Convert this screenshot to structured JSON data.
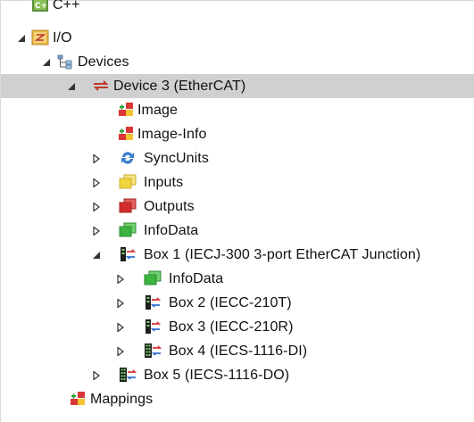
{
  "tree": {
    "nodes": [
      {
        "label": "C++",
        "icon": "cpp-project-icon",
        "toggle": "none"
      },
      {
        "label": "I/O",
        "icon": "io-folder-icon",
        "toggle": "expanded"
      },
      {
        "label": "Devices",
        "icon": "devices-icon",
        "toggle": "expanded"
      },
      {
        "label": "Device 3 (EtherCAT)",
        "icon": "ethercat-device-icon",
        "toggle": "expanded",
        "selected": true
      },
      {
        "label": "Image",
        "icon": "image-icon",
        "toggle": "none"
      },
      {
        "label": "Image-Info",
        "icon": "image-info-icon",
        "toggle": "none"
      },
      {
        "label": "SyncUnits",
        "icon": "syncunits-icon",
        "toggle": "collapsed"
      },
      {
        "label": "Inputs",
        "icon": "inputs-icon",
        "toggle": "collapsed"
      },
      {
        "label": "Outputs",
        "icon": "outputs-icon",
        "toggle": "collapsed"
      },
      {
        "label": "InfoData",
        "icon": "infodata-icon",
        "toggle": "collapsed"
      },
      {
        "label": "Box 1 (IECJ-300 3-port EtherCAT Junction)",
        "icon": "box-icon",
        "toggle": "expanded"
      },
      {
        "label": "InfoData",
        "icon": "infodata-icon",
        "toggle": "collapsed"
      },
      {
        "label": "Box 2 (IECC-210T)",
        "icon": "box-icon",
        "toggle": "collapsed"
      },
      {
        "label": "Box 3 (IECC-210R)",
        "icon": "box-icon",
        "toggle": "collapsed"
      },
      {
        "label": "Box 4 (IECS-1116-DI)",
        "icon": "box-io-icon",
        "toggle": "collapsed"
      },
      {
        "label": "Box 5 (IECS-1116-DO)",
        "icon": "box-io-icon",
        "toggle": "collapsed"
      },
      {
        "label": "Mappings",
        "icon": "mappings-icon",
        "toggle": "none"
      }
    ]
  }
}
